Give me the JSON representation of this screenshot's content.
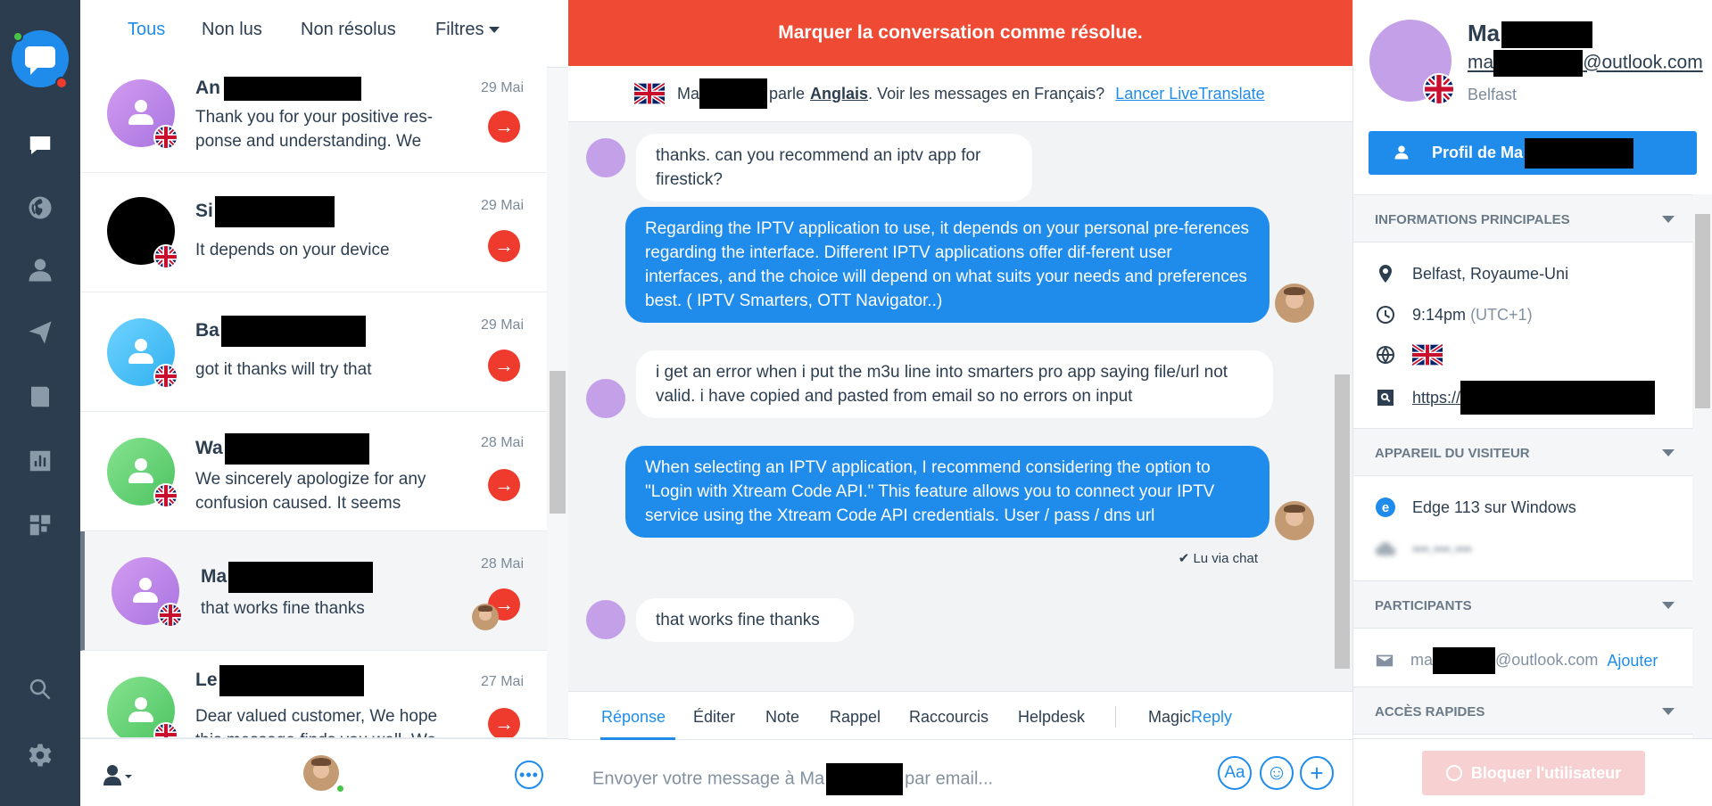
{
  "list_tabs": {
    "all": "Tous",
    "unread": "Non lus",
    "unresolved": "Non résolus",
    "filters": "Filtres"
  },
  "conversations": [
    {
      "name": "An",
      "date": "29 Mai",
      "preview": "Thank you for your positive res-ponse and understanding. We",
      "avatar_color": "#c188e9"
    },
    {
      "name": "Si",
      "date": "29 Mai",
      "preview": "It depends on your device",
      "avatar_color": "#000000"
    },
    {
      "name": "Ba",
      "date": "29 Mai",
      "preview": "got it thanks will try that",
      "avatar_color": "#4fc3f7"
    },
    {
      "name": "Wa",
      "date": "28 Mai",
      "preview": "We sincerely apologize for any confusion caused. It seems",
      "avatar_color": "#6bd47a"
    },
    {
      "name": "Ma",
      "date": "28 Mai",
      "preview": "that works fine thanks",
      "avatar_color": "#c188e9"
    },
    {
      "name": "Le",
      "date": "27 Mai",
      "preview": "Dear valued customer, We hope this message finds you well. We",
      "avatar_color": "#6bd47a"
    }
  ],
  "chat": {
    "resolve_banner": "Marquer la conversation comme résolue.",
    "lang_name": "Ma",
    "lang_speaks": "parle",
    "lang_language": "Anglais",
    "lang_prompt": ". Voir les messages en Français?",
    "lang_link": "Lancer LiveTranslate",
    "messages": [
      {
        "dir": "in",
        "text": "thanks. can you recommend an iptv app for firestick?"
      },
      {
        "dir": "out",
        "text": "Regarding the IPTV application to use, it depends on your personal pre-ferences regarding the interface. Different IPTV applications offer dif-ferent user interfaces, and the choice will depend on what suits your needs and preferences best. ( IPTV Smarters, OTT Navigator..)"
      },
      {
        "dir": "in",
        "text": "i get an error when i put the m3u line into smarters pro app saying file/url not valid. i have copied and pasted from email so no errors on input"
      },
      {
        "dir": "out",
        "text": "When selecting an IPTV application, I recommend considering the option to \"Login with Xtream Code API.\" This feature allows you to connect your IPTV service using the Xtream Code API credentials. User / pass / dns url"
      },
      {
        "dir": "in",
        "text": "that works fine thanks"
      }
    ],
    "read_receipt": "✔ Lu via chat",
    "reply_tabs": [
      "Réponse",
      "Éditer",
      "Note",
      "Rappel",
      "Raccourcis",
      "Helpdesk"
    ],
    "magic_reply_a": "Magic",
    "magic_reply_b": "Reply",
    "composer_placeholder_a": "Envoyer votre message à Ma",
    "composer_placeholder_b": "par email...",
    "composer_buttons": {
      "format": "Aa",
      "emoji": "☺",
      "add": "+"
    }
  },
  "visitor": {
    "name": "Ma",
    "email_a": "ma",
    "email_b": "@outlook.com",
    "city": "Belfast",
    "profile_button": "Profil de Ma",
    "sections": {
      "main": "Informations principales",
      "device": "Appareil du visiteur",
      "participants": "Participants",
      "quick": "Accès rapides"
    },
    "location": "Belfast, Royaume-Uni",
    "time": "9:14pm",
    "timezone": "(UTC+1)",
    "website": "https://",
    "browser": "Edge 113 sur Windows",
    "ip_hidden": "•••.•••.•••",
    "participant_a": "ma",
    "participant_b": "@outlook.com",
    "participant_add": "Ajouter",
    "block_button": "Bloquer l'utilisateur"
  },
  "colors": {
    "accent": "#1f8ceb",
    "resolve": "#ef4a33",
    "rail": "#2b3d4f"
  }
}
